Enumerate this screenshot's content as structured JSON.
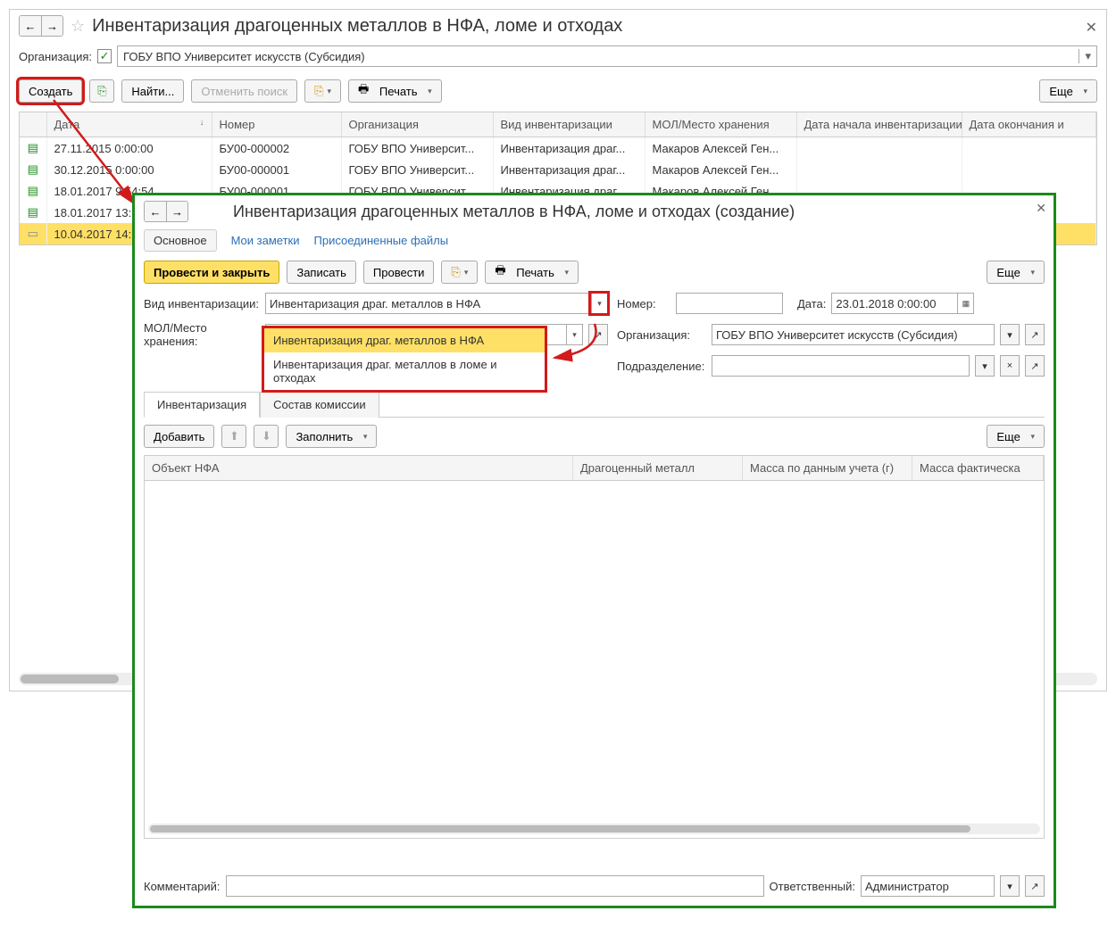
{
  "outer": {
    "title": "Инвентаризация драгоценных металлов в НФА, ломе и отходах",
    "filter": {
      "label": "Организация:",
      "checked": true,
      "value": "ГОБУ ВПО Университет искусств (Субсидия)"
    },
    "toolbar": {
      "create": "Создать",
      "find": "Найти...",
      "cancel_search": "Отменить поиск",
      "print": "Печать",
      "more": "Еще"
    },
    "columns": {
      "date": "Дата",
      "number": "Номер",
      "org": "Организация",
      "type": "Вид инвентаризации",
      "mol": "МОЛ/Место хранения",
      "start": "Дата начала инвентаризации",
      "end": "Дата окончания и"
    },
    "rows": [
      {
        "icon": "doc",
        "date": "27.11.2015 0:00:00",
        "number": "БУ00-000002",
        "org": "ГОБУ ВПО Университ...",
        "type": "Инвентаризация драг...",
        "mol": "Макаров Алексей Ген..."
      },
      {
        "icon": "doc",
        "date": "30.12.2015 0:00:00",
        "number": "БУ00-000001",
        "org": "ГОБУ ВПО Университ...",
        "type": "Инвентаризация драг...",
        "mol": "Макаров Алексей Ген..."
      },
      {
        "icon": "doc",
        "date": "18.01.2017 9:54:54",
        "number": "БУ00-000001",
        "org": "ГОБУ ВПО Университ...",
        "type": "Инвентаризация драг...",
        "mol": "Макаров Алексей Ген..."
      },
      {
        "icon": "doc",
        "date": "18.01.2017 13:",
        "number": "",
        "org": "",
        "type": "",
        "mol": ""
      },
      {
        "icon": "draft",
        "date": "10.04.2017 14:",
        "number": "",
        "org": "",
        "type": "",
        "mol": ""
      }
    ]
  },
  "inner": {
    "title": "Инвентаризация драгоценных металлов в НФА, ломе и отходах (создание)",
    "subtabs": {
      "main": "Основное",
      "notes": "Мои заметки",
      "files": "Присоединенные файлы"
    },
    "cmd": {
      "post_close": "Провести и закрыть",
      "save": "Записать",
      "post": "Провести",
      "print": "Печать",
      "more": "Еще"
    },
    "fields": {
      "type_label": "Вид инвентаризации:",
      "type_value": "Инвентаризация драг. металлов в НФА",
      "mol_label": "МОЛ/Место хранения:",
      "mol_value": "",
      "number_label": "Номер:",
      "number_value": "",
      "date_label": "Дата:",
      "date_value": "23.01.2018  0:00:00",
      "org_label": "Организация:",
      "org_value": "ГОБУ ВПО Университет искусств (Субсидия)",
      "dept_label": "Подразделение:",
      "dept_value": ""
    },
    "dropdown": {
      "opt1": "Инвентаризация драг. металлов в НФА",
      "opt2": "Инвентаризация драг. металлов в ломе и отходах"
    },
    "sectabs": {
      "inv": "Инвентаризация",
      "comm": "Состав комиссии"
    },
    "sec_toolbar": {
      "add": "Добавить",
      "fill": "Заполнить",
      "more": "Еще"
    },
    "sec_columns": {
      "obj": "Объект НФА",
      "metal": "Драгоценный металл",
      "mass_book": "Масса по данным учета (г)",
      "mass_fact": "Масса фактическа"
    },
    "footer": {
      "comment_label": "Комментарий:",
      "comment_value": "",
      "resp_label": "Ответственный:",
      "resp_value": "Администратор"
    }
  }
}
